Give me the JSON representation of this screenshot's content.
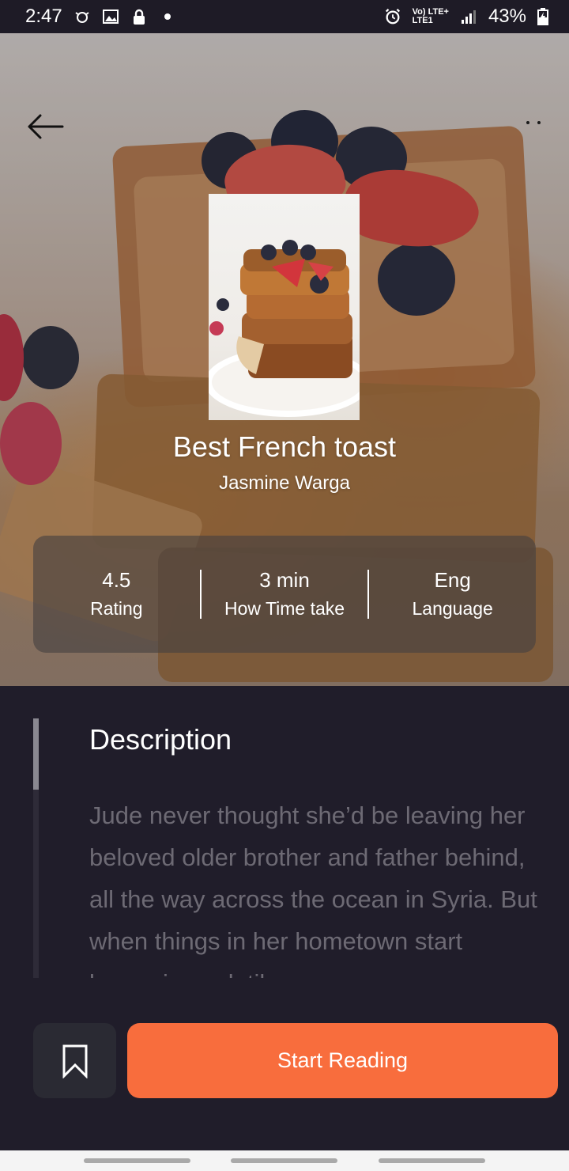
{
  "status_bar": {
    "time": "2:47",
    "network_top": "Vo) LTE+",
    "network_bottom": "LTE1",
    "battery": "43%"
  },
  "header": {
    "back_icon": "arrow-left-icon",
    "more_icon": "more-dots-icon"
  },
  "book": {
    "title": "Best French toast",
    "author": "Jasmine Warga"
  },
  "stats": [
    {
      "value": "4.5",
      "label": "Rating"
    },
    {
      "value": "3 min",
      "label": "How Time take"
    },
    {
      "value": "Eng",
      "label": "Language"
    }
  ],
  "description": {
    "heading": "Description",
    "text": "Jude never thought she’d be leaving her beloved older brother and father behind, all the way across the ocean in Syria. But when things in her hometown start becoming volatile"
  },
  "actions": {
    "bookmark_icon": "bookmark-icon",
    "start_label": "Start Reading"
  },
  "colors": {
    "background": "#201d2a",
    "accent": "#f86d3d",
    "muted_text": "#6d6a74"
  }
}
